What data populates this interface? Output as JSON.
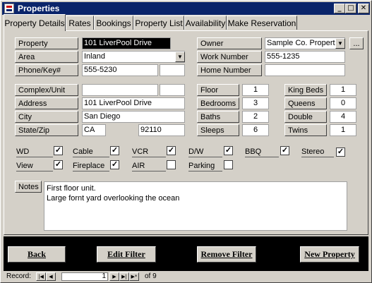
{
  "window": {
    "title": "Properties",
    "min": "_",
    "max": "□",
    "close": "✕"
  },
  "tabs": [
    "Property Details",
    "Rates",
    "Bookings",
    "Property List",
    "Availability",
    "Make Reservation"
  ],
  "fields": {
    "property": {
      "label": "Property",
      "value": "101 LiverPool Drive"
    },
    "area": {
      "label": "Area",
      "value": "Inland"
    },
    "phone": {
      "label": "Phone/Key#",
      "value": "555-5230",
      "extra": ""
    },
    "owner": {
      "label": "Owner",
      "value": "Sample Co. Propertie",
      "more": "..."
    },
    "work_number": {
      "label": "Work Number",
      "value": "555-1235"
    },
    "home_number": {
      "label": "Home Number",
      "value": ""
    },
    "complex": {
      "label": "Complex/Unit",
      "value": "",
      "extra": ""
    },
    "address": {
      "label": "Address",
      "value": "101 LiverPool Drive"
    },
    "city": {
      "label": "City",
      "value": "San Diego"
    },
    "state_zip": {
      "label": "State/Zip",
      "state": "CA",
      "zip": "92110"
    },
    "floor": {
      "label": "Floor",
      "value": "1"
    },
    "bedrooms": {
      "label": "Bedrooms",
      "value": "3"
    },
    "baths": {
      "label": "Baths",
      "value": "2"
    },
    "sleeps": {
      "label": "Sleeps",
      "value": "6"
    },
    "king_beds": {
      "label": "King Beds",
      "value": "1"
    },
    "queens": {
      "label": "Queens",
      "value": "0"
    },
    "double": {
      "label": "Double",
      "value": "4"
    },
    "twins": {
      "label": "Twins",
      "value": "1"
    }
  },
  "amenities": [
    {
      "label": "WD",
      "checked": true
    },
    {
      "label": "Cable",
      "checked": true
    },
    {
      "label": "VCR",
      "checked": true
    },
    {
      "label": "D/W",
      "checked": true
    },
    {
      "label": "BBQ",
      "checked": true
    },
    {
      "label": "Stereo",
      "checked": true
    },
    {
      "label": "View",
      "checked": true
    },
    {
      "label": "Fireplace",
      "checked": true
    },
    {
      "label": "AIR",
      "checked": false
    },
    {
      "label": "Parking",
      "checked": false
    }
  ],
  "notes": {
    "label": "Notes",
    "line1": "First floor unit.",
    "line2": "Large fornt yard overlooking the ocean"
  },
  "buttons": {
    "back": "Back",
    "edit_filter": "Edit Filter",
    "remove_filter": "Remove Filter",
    "new_property": "New Property"
  },
  "nav": {
    "label": "Record:",
    "current": "1",
    "of_text": "of 9"
  }
}
